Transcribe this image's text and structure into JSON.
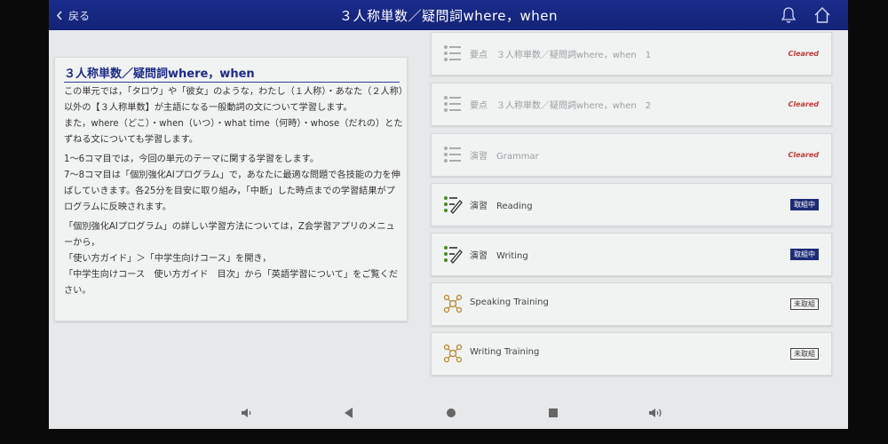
{
  "header": {
    "back_label": "戻る",
    "title": "３人称単数／疑問詞where，when",
    "icons": [
      "bell-icon",
      "home-icon"
    ]
  },
  "lesson": {
    "title": "３人称単数／疑問詞where，when",
    "paragraphs": [
      "この単元では，「タロウ」や「彼女」のような，わたし（１人称）・あなた（２人称）以外の【３人称単数】が主語になる一般動詞の文について学習します。\nまた，where（どこ）・when（いつ）・what time（何時）・whose（だれの）とたずねる文についても学習します。",
      "1～6コマ目では，今回の単元のテーマに関する学習をします。\n7～8コマ目は「個別強化AIプログラム」で，あなたに最適な問題で各技能の力を伸ばしていきます。各25分を目安に取り組み，「中断」した時点までの学習結果がプログラムに反映されます。",
      "「個別強化AIプログラム」の詳しい学習方法については，Z会学習アプリのメニューから，\n「使い方ガイド」＞「中学生向けコース」を開き，\n「中学生向けコース　使い方ガイド　目次」から「英語学習について」をご覧ください。"
    ]
  },
  "items": [
    {
      "label": "要点　３人称単数／疑問詞where，when　1",
      "status": "Cleared",
      "icon": "list-icon"
    },
    {
      "label": "要点　３人称単数／疑問詞where，when　2",
      "status": "Cleared",
      "icon": "list-icon"
    },
    {
      "label": "演習　Grammar",
      "status": "Cleared",
      "icon": "list-icon"
    },
    {
      "label": "演習　Reading",
      "status": "取組中",
      "icon": "list-pencil-icon"
    },
    {
      "label": "演習　Writing",
      "status": "取組中",
      "icon": "list-pencil-icon"
    },
    {
      "label": "Speaking Training",
      "status": "未取組",
      "icon": "network-icon"
    },
    {
      "label": "Writing Training",
      "status": "未取組",
      "icon": "network-icon"
    }
  ],
  "colors": {
    "header": "#132377",
    "cleared": "#c43a3a",
    "in_progress": "#1d2b76",
    "accent_green": "#4a8a2a"
  },
  "navbar": [
    "volume-down-icon",
    "back-triangle-icon",
    "home-circle-icon",
    "recents-square-icon",
    "volume-up-icon"
  ]
}
